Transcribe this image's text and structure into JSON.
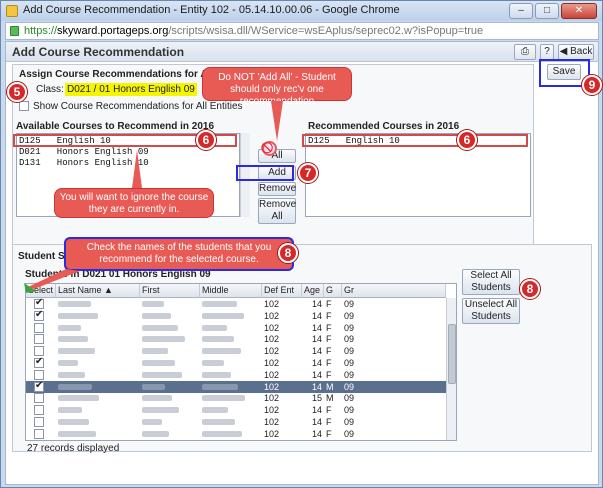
{
  "window": {
    "title": "Add Course Recommendation - Entity 102 - 05.14.10.00.06 - Google Chrome",
    "url_scheme": "https://",
    "url_domain": "skyward.portageps.org",
    "url_path": "/scripts/wsisa.dll/WService=wsEAplus/seprec02.w?isPopup=true"
  },
  "header": {
    "title": "Add Course Recommendation",
    "print_icon": "printer-icon",
    "help_label": "?",
    "back_label": "◀ Back",
    "save_label": "Save"
  },
  "assign": {
    "heading": "Assign Course Recommendations for All Sele",
    "class_label": "Class:",
    "class_value": "D021 / 01 Honors English 09",
    "show_all_label": "Show Course Recommendations for All Entities"
  },
  "available": {
    "heading": "Available Courses to Recommend in 2016",
    "items": [
      "D125   English 10",
      "D021   Honors English 09",
      "D131   Honors English 10"
    ]
  },
  "recommended": {
    "heading": "Recommended Courses in 2016",
    "items": [
      "D125   English 10"
    ]
  },
  "buttons": {
    "add_all": "All",
    "add": "Add",
    "remove": "Remove",
    "remove_all_1": "Remove",
    "remove_all_2": "All",
    "select_all_1": "Select All",
    "select_all_2": "Students",
    "unselect_all_1": "Unselect All",
    "unselect_all_2": "Students"
  },
  "students": {
    "section_label": "Student Se",
    "grid_title": "Students in D021 01 Honors English 09",
    "columns": [
      "Select",
      "Last Name ▲",
      "First",
      "Middle",
      "Def Ent",
      "Age",
      "G",
      "Gr"
    ],
    "rows": [
      {
        "checked": true,
        "ent": "102",
        "age": "14",
        "g": "F",
        "gr": "09",
        "selected": false
      },
      {
        "checked": true,
        "ent": "102",
        "age": "14",
        "g": "F",
        "gr": "09",
        "selected": false
      },
      {
        "checked": false,
        "ent": "102",
        "age": "14",
        "g": "F",
        "gr": "09",
        "selected": false
      },
      {
        "checked": false,
        "ent": "102",
        "age": "14",
        "g": "F",
        "gr": "09",
        "selected": false
      },
      {
        "checked": false,
        "ent": "102",
        "age": "14",
        "g": "F",
        "gr": "09",
        "selected": false
      },
      {
        "checked": true,
        "ent": "102",
        "age": "14",
        "g": "F",
        "gr": "09",
        "selected": false
      },
      {
        "checked": false,
        "ent": "102",
        "age": "14",
        "g": "F",
        "gr": "09",
        "selected": false
      },
      {
        "checked": true,
        "ent": "102",
        "age": "14",
        "g": "M",
        "gr": "09",
        "selected": true
      },
      {
        "checked": false,
        "ent": "102",
        "age": "15",
        "g": "M",
        "gr": "09",
        "selected": false
      },
      {
        "checked": false,
        "ent": "102",
        "age": "14",
        "g": "F",
        "gr": "09",
        "selected": false
      },
      {
        "checked": false,
        "ent": "102",
        "age": "14",
        "g": "F",
        "gr": "09",
        "selected": false
      },
      {
        "checked": false,
        "ent": "102",
        "age": "14",
        "g": "F",
        "gr": "09",
        "selected": false
      }
    ],
    "records_label": "27 records displayed"
  },
  "annotations": {
    "callout_add_all": "Do NOT 'Add All' - Student should only rec'v one recommendation",
    "callout_ignore": "You will want to ignore the course they are currently in.",
    "callout_check": "Check the names of the students that you recommend for the selected course.",
    "badge5": "5",
    "badge6a": "6",
    "badge6b": "6",
    "badge7": "7",
    "badge8a": "8",
    "badge8b": "8",
    "badge9": "9"
  },
  "colors": {
    "callout": "#e85b55",
    "badge": "#d62828",
    "class_highlight": "#f5f500",
    "selected_row": "#5b6f8f"
  }
}
